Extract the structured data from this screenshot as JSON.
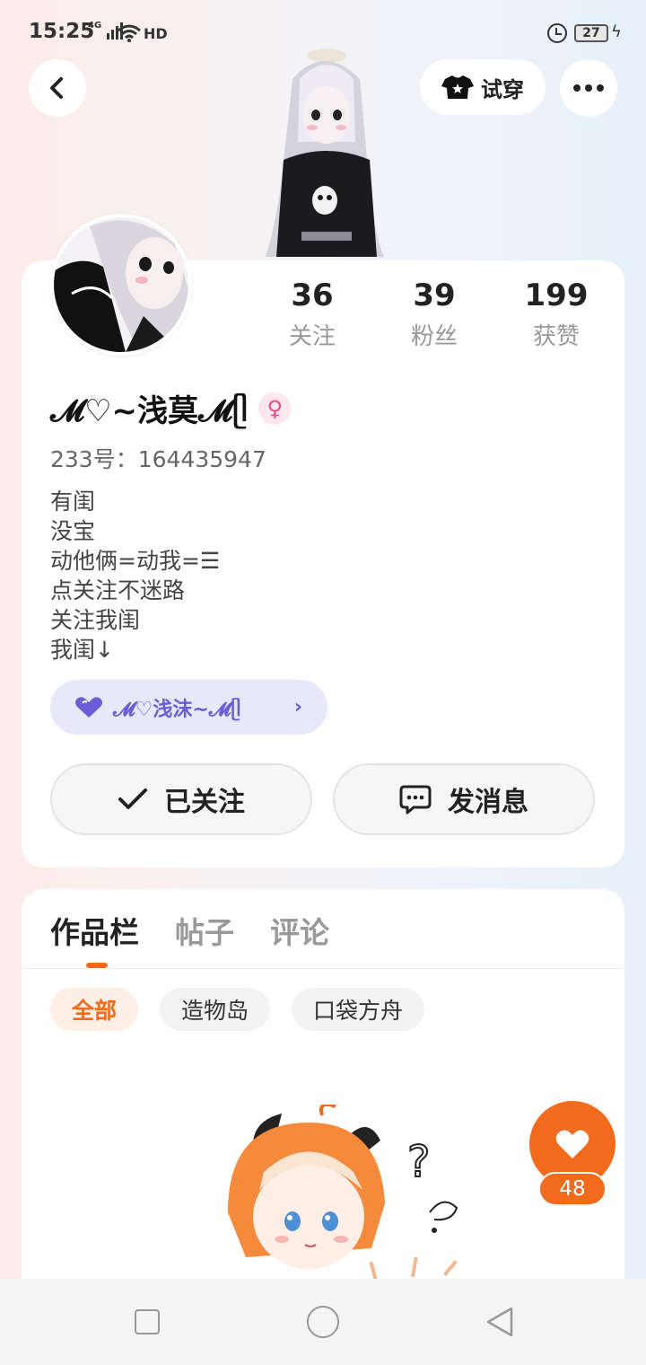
{
  "status_bar": {
    "time": "15:25",
    "network": "4G",
    "wifi_label": "HD",
    "battery": "27"
  },
  "header": {
    "try_on_label": "试穿"
  },
  "profile": {
    "stats": [
      {
        "value": "36",
        "label": "关注"
      },
      {
        "value": "39",
        "label": "粉丝"
      },
      {
        "value": "199",
        "label": "获赞"
      }
    ],
    "name": "𝓜♡~浅莫𝓜ᥫ",
    "gender_symbol": "♀",
    "uid": "233号：164435947",
    "bio": [
      "有闺",
      "没宝",
      "动他俩=动我=☰",
      "点关注不迷路",
      "关注我闺",
      "我闺↓"
    ],
    "linked_account": "𝓜♡浅沫~𝓜ᥫ",
    "follow_label": "已关注",
    "message_label": "发消息"
  },
  "works": {
    "tabs": [
      {
        "label": "作品栏",
        "active": true
      },
      {
        "label": "帖子",
        "active": false
      },
      {
        "label": "评论",
        "active": false
      }
    ],
    "filters": [
      {
        "label": "全部",
        "active": true
      },
      {
        "label": "造物岛",
        "active": false
      },
      {
        "label": "口袋方舟",
        "active": false
      }
    ]
  },
  "like": {
    "count": "48"
  },
  "colors": {
    "accent": "#f26b1d",
    "pill_bg": "#e8e8fb",
    "pill_text": "#6a5ed8",
    "gender": "#ee4b88"
  },
  "icons": [
    "back-arrow-icon",
    "shirt-icon",
    "more-icon",
    "heart-icon",
    "check-icon",
    "chat-bubble-icon",
    "chevron-right-icon"
  ]
}
